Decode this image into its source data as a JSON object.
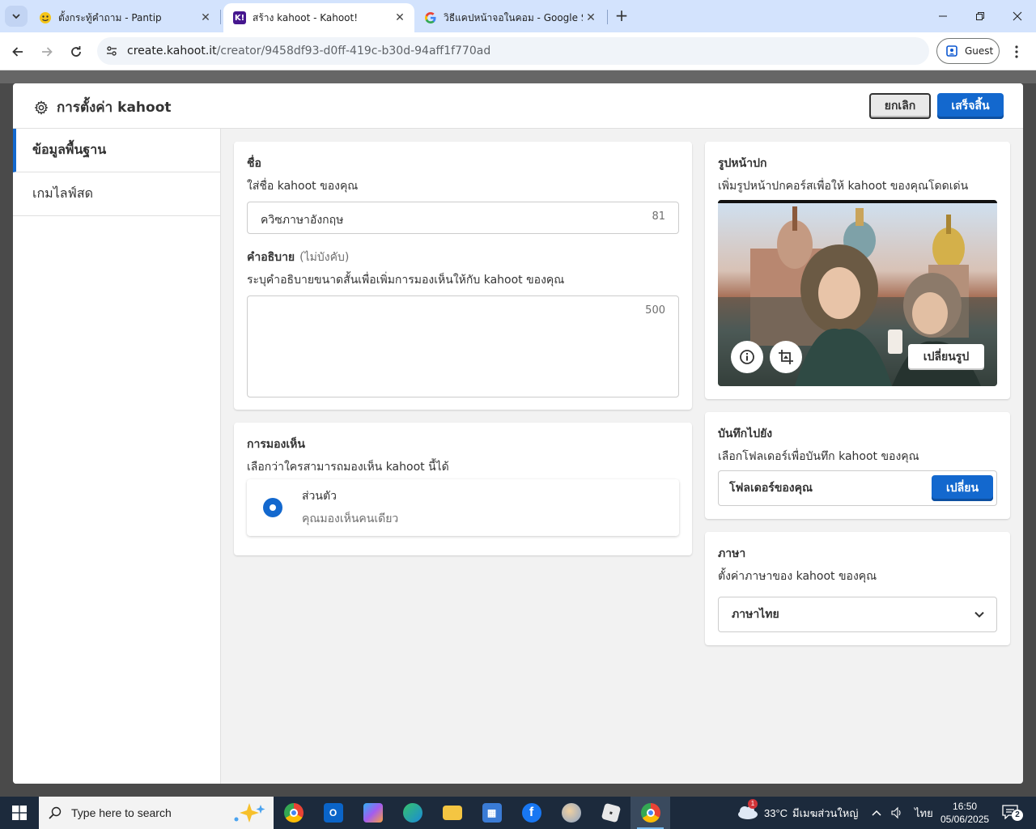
{
  "browser": {
    "tabs": [
      {
        "title": "ตั้งกระทู้คำถาม - Pantip",
        "favicon": "pantip-icon"
      },
      {
        "title": "สร้าง kahoot - Kahoot!",
        "favicon": "kahoot-icon",
        "active": true
      },
      {
        "title": "วิธีแคปหน้าจอในคอม - Google Search",
        "favicon": "google-icon"
      }
    ],
    "url_host": "create.kahoot.it",
    "url_path": "/creator/9458df93-d0ff-419c-b30d-94aff1f770ad",
    "profile_label": "Guest"
  },
  "modal": {
    "title": "การตั้งค่า kahoot",
    "cancel_label": "ยกเลิก",
    "done_label": "เสร็จสิ้น",
    "nav": [
      {
        "label": "ข้อมูลพื้นฐาน",
        "active": true
      },
      {
        "label": "เกมไลฟ์สด",
        "active": false
      }
    ],
    "name": {
      "heading": "ชื่อ",
      "sub": "ใส่ชื่อ kahoot ของคุณ",
      "value": "ควิซภาษาอังกฤษ",
      "counter": "81"
    },
    "description": {
      "heading": "คำอธิบาย",
      "optional": "(ไม่บังคับ)",
      "sub": "ระบุคำอธิบายขนาดสั้นเพื่อเพิ่มการมองเห็นให้กับ kahoot ของคุณ",
      "value": "",
      "counter": "500"
    },
    "visibility": {
      "heading": "การมองเห็น",
      "sub": "เลือกว่าใครสามารถมองเห็น kahoot นี้ได้",
      "option_title": "ส่วนตัว",
      "option_sub": "คุณมองเห็นคนเดียว"
    },
    "cover": {
      "heading": "รูปหน้าปก",
      "sub": "เพิ่มรูปหน้าปกคอร์สเพื่อให้ kahoot ของคุณโดดเด่น",
      "change_label": "เปลี่ยนรูป"
    },
    "save_to": {
      "heading": "บันทึกไปยัง",
      "sub": "เลือกโฟลเดอร์เพื่อบันทึก kahoot ของคุณ",
      "folder": "โฟลเดอร์ของคุณ",
      "change_label": "เปลี่ยน"
    },
    "language": {
      "heading": "ภาษา",
      "sub": "ตั้งค่าภาษาของ kahoot ของคุณ",
      "selected": "ภาษาไทย"
    }
  },
  "taskbar": {
    "search_placeholder": "Type here to search",
    "weather_temp": "33°C",
    "weather_text": "มีเมฆส่วนใหญ่",
    "weather_badge": "1",
    "language": "ไทย",
    "time": "16:50",
    "date": "05/06/2025",
    "notification_count": "2"
  },
  "colors": {
    "accent": "#1368ce",
    "tabstrip": "#d3e3fd",
    "taskbar": "#1c2a3c"
  }
}
